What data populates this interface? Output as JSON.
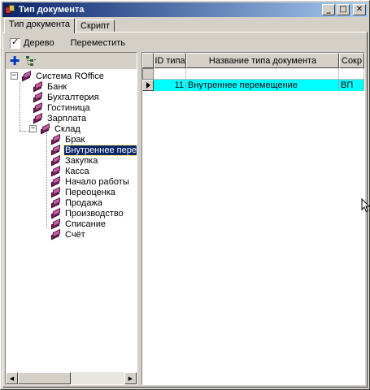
{
  "window": {
    "title": "Тип документа"
  },
  "titlebar_buttons": {
    "minimize": "_",
    "maximize": "□",
    "close": "✕"
  },
  "tabs": [
    {
      "label": "Тип документа"
    },
    {
      "label": "Скрипт"
    }
  ],
  "toolbar": {
    "tree_checkbox_label": "Дерево",
    "tree_checked": true,
    "move_label": "Переместить"
  },
  "tree_toolbar": {
    "add_icon": "plus-icon",
    "tree_icon": "tree-view-icon"
  },
  "tree": {
    "root": "Система ROffice",
    "root_children": [
      "Банк",
      "Бухгалтерия",
      "Гостиница",
      "Зарплата",
      "Склад"
    ],
    "expanded_node": "Склад",
    "selected": "Внутреннее перемещ",
    "sklad_children": [
      "Брак",
      "Внутреннее перемещ",
      "Закупка",
      "Касса",
      "Начало работы",
      "Переоценка",
      "Продажа",
      "Производство",
      "Списание",
      "Счёт"
    ],
    "expander_minus": "−"
  },
  "scrollbar": {
    "left_arrow": "◀",
    "right_arrow": "▶"
  },
  "grid": {
    "columns": [
      "ID типа",
      "Название типа документа",
      "Сокр"
    ],
    "rows": [
      {
        "id": "11",
        "name": "Внутреннее перемещение",
        "short": "ВП",
        "selected_color": "#00ffff"
      }
    ]
  }
}
